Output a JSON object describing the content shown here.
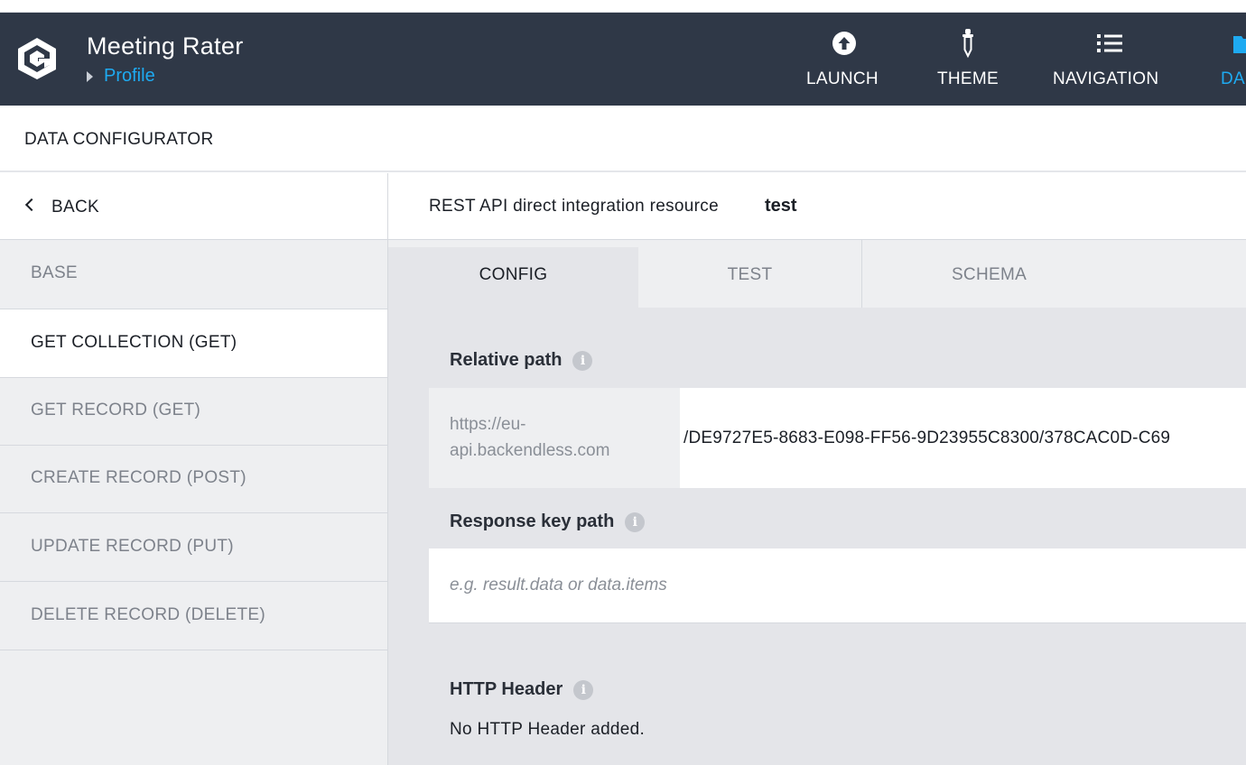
{
  "header": {
    "app_title": "Meeting Rater",
    "breadcrumb": "Profile",
    "nav": [
      {
        "label": "LAUNCH",
        "icon": "upload-circle-icon"
      },
      {
        "label": "THEME",
        "icon": "eyedropper-icon"
      },
      {
        "label": "NAVIGATION",
        "icon": "list-icon"
      },
      {
        "label": "DA",
        "icon": "folder-icon"
      }
    ]
  },
  "page_title": "DATA CONFIGURATOR",
  "sidebar": {
    "back_label": "BACK",
    "items": [
      {
        "label": "BASE",
        "active": false
      },
      {
        "label": "GET COLLECTION (GET)",
        "active": true
      },
      {
        "label": "GET RECORD (GET)",
        "active": false
      },
      {
        "label": "CREATE RECORD (POST)",
        "active": false
      },
      {
        "label": "UPDATE RECORD (PUT)",
        "active": false
      },
      {
        "label": "DELETE RECORD (DELETE)",
        "active": false
      }
    ]
  },
  "resource": {
    "label": "REST API direct integration resource",
    "name": "test"
  },
  "tabs": [
    {
      "label": "CONFIG",
      "active": true
    },
    {
      "label": "TEST",
      "active": false
    },
    {
      "label": "SCHEMA",
      "active": false
    }
  ],
  "form": {
    "relative_path_label": "Relative path",
    "base_url": "https://eu-api.backendless.com",
    "relative_path_value": "/DE9727E5-8683-E098-FF56-9D23955C8300/378CAC0D-C69",
    "response_key_label": "Response key path",
    "response_key_placeholder": "e.g. result.data or data.items",
    "http_header_label": "HTTP Header",
    "http_header_empty": "No HTTP Header added.",
    "info_glyph": "i"
  },
  "colors": {
    "header_bg": "#2f3847",
    "accent": "#1eaaf1",
    "sidebar_bg": "#eeeff1",
    "content_bg": "#e4e5e9"
  }
}
